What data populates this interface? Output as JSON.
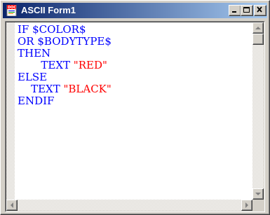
{
  "window": {
    "title": "ASCII Form1",
    "icon": "doc-icon",
    "controls": {
      "minimize": "minimize-icon",
      "maximize": "maximize-icon",
      "close": "close-icon"
    }
  },
  "editor": {
    "lines": [
      [
        {
          "text": "IF ",
          "kind": "kw"
        },
        {
          "text": "$COLOR$",
          "kind": "kw"
        }
      ],
      [
        {
          "text": "OR ",
          "kind": "kw"
        },
        {
          "text": "$BODYTYPE$",
          "kind": "kw"
        }
      ],
      [
        {
          "text": "THEN",
          "kind": "kw"
        }
      ],
      [
        {
          "text": "       TEXT ",
          "kind": "kw"
        },
        {
          "text": "\"RED\"",
          "kind": "str"
        }
      ],
      [
        {
          "text": "ELSE",
          "kind": "kw"
        }
      ],
      [
        {
          "text": "    TEXT ",
          "kind": "kw"
        },
        {
          "text": "\"BLACK\"",
          "kind": "str"
        }
      ],
      [
        {
          "text": "ENDIF",
          "kind": "kw"
        }
      ]
    ]
  },
  "colors": {
    "keyword": "#0000ff",
    "string": "#ff0000",
    "titlebar_start": "#0a246a",
    "titlebar_end": "#a6caf0"
  }
}
